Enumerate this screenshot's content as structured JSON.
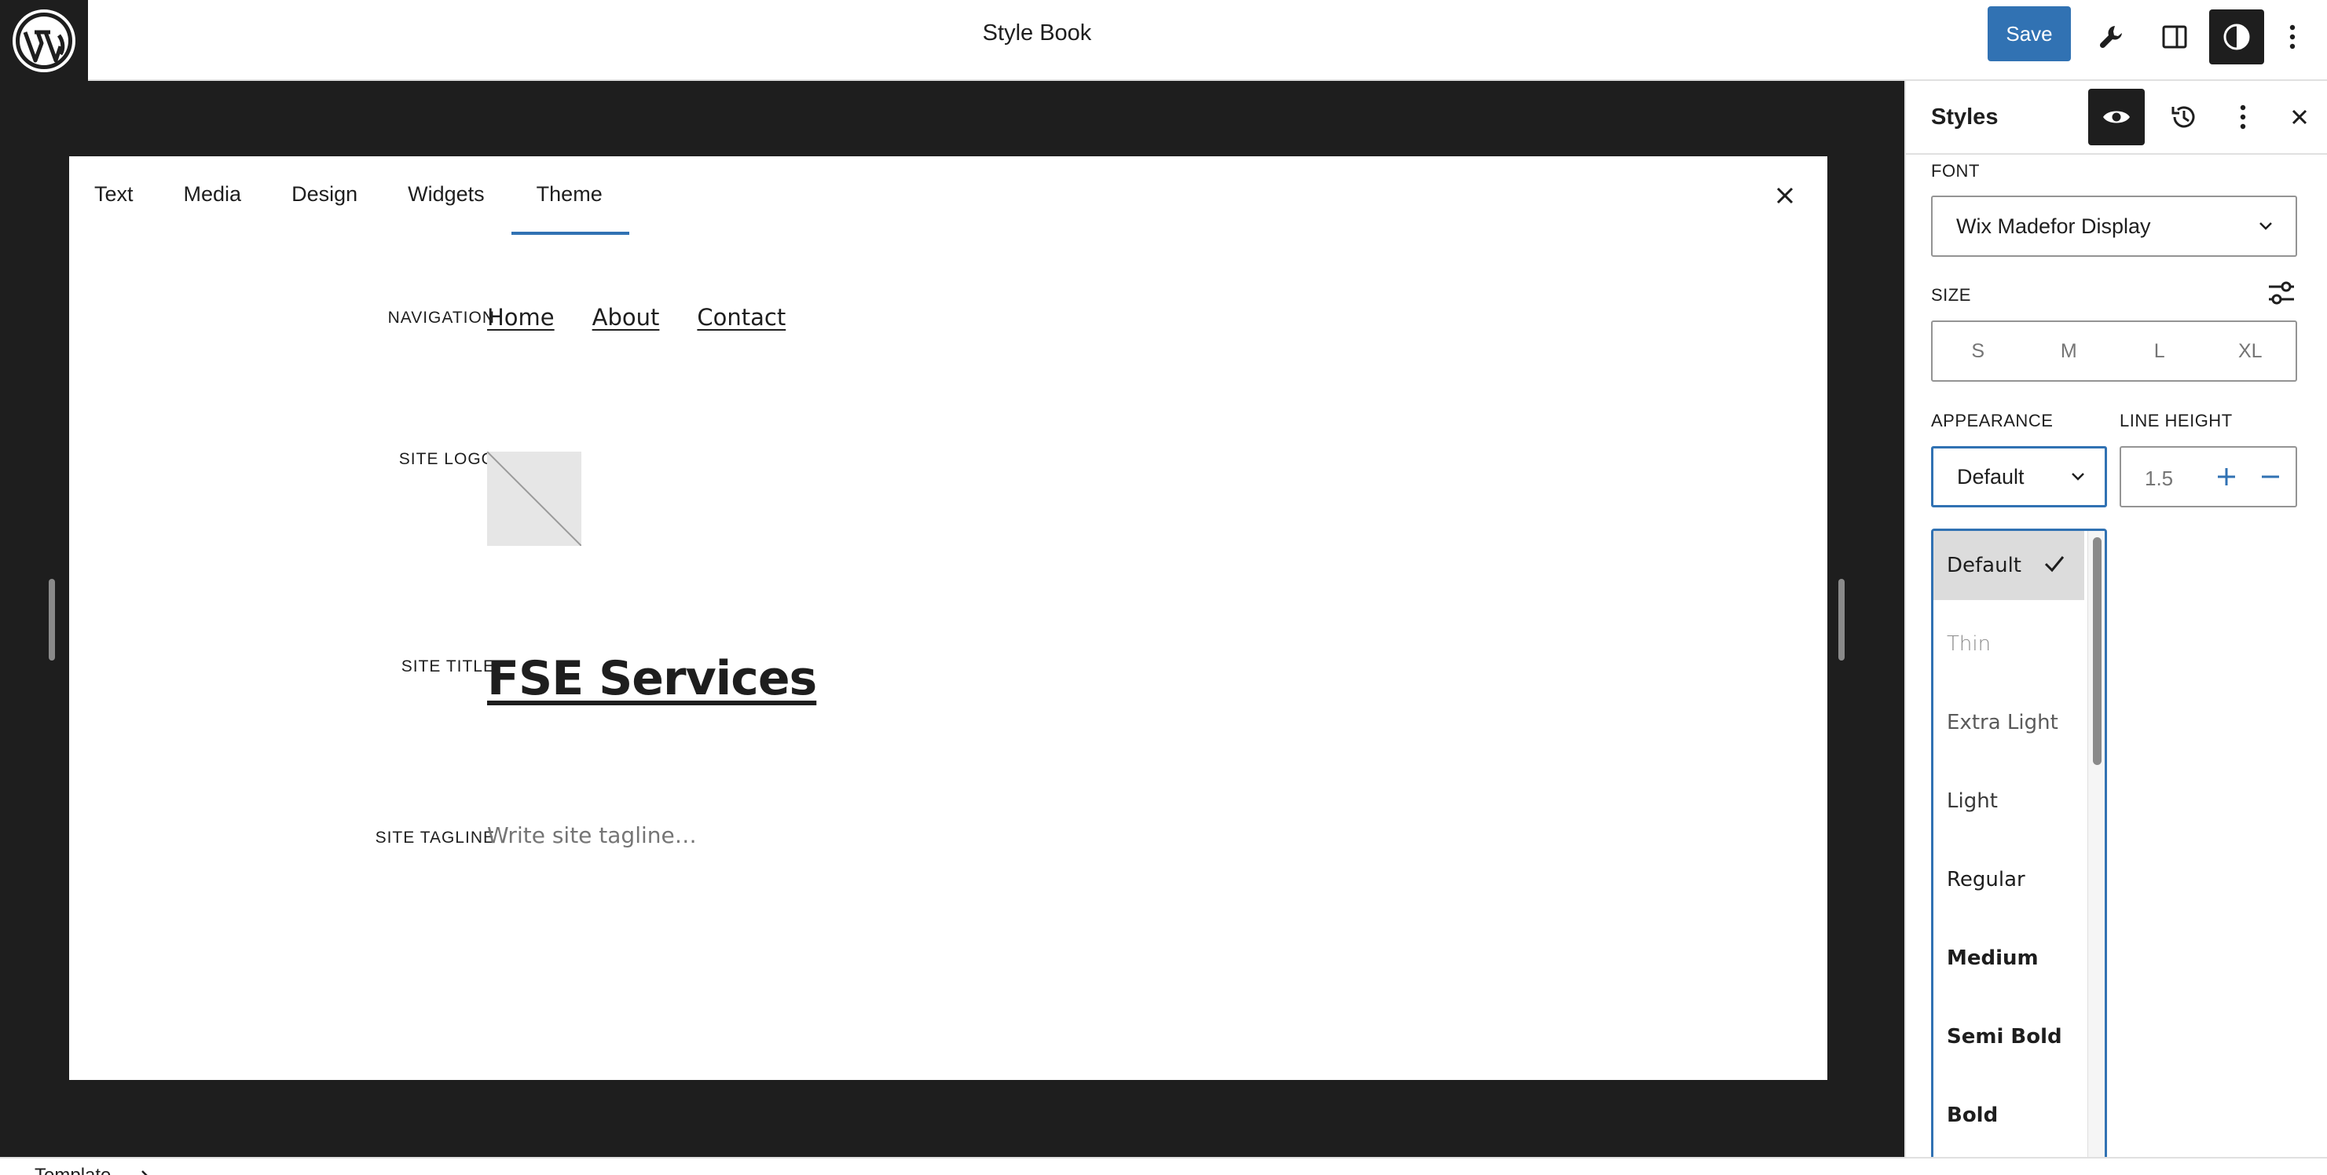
{
  "header": {
    "title": "Style Book",
    "save_label": "Save",
    "icons": [
      "wordpress-logo",
      "tools-icon",
      "sidebar-toggle-icon",
      "styles-contrast-icon",
      "options-icon"
    ]
  },
  "stylebook": {
    "tabs": [
      {
        "label": "Text"
      },
      {
        "label": "Media"
      },
      {
        "label": "Design"
      },
      {
        "label": "Widgets"
      },
      {
        "label": "Theme"
      }
    ],
    "active_tab": "Theme",
    "rows": {
      "navigation_label": "NAVIGATION",
      "nav_links": [
        "Home",
        "About",
        "Contact"
      ],
      "site_logo_label": "SITE LOGO",
      "site_title_label": "SITE TITLE",
      "site_title": "FSE Services",
      "site_tagline_label": "SITE TAGLINE",
      "tagline_placeholder": "Write site tagline…"
    }
  },
  "footer": {
    "breadcrumb": "Template"
  },
  "sidebar": {
    "title": "Styles",
    "font_label": "FONT",
    "font_value": "Wix Madefor Display",
    "size_label": "SIZE",
    "size_options": [
      "S",
      "M",
      "L",
      "XL"
    ],
    "appearance_label": "APPEARANCE",
    "appearance_value": "Default",
    "line_height_label": "LINE HEIGHT",
    "line_height_value": "1.5",
    "appearance_options": [
      "Default",
      "Thin",
      "Extra Light",
      "Light",
      "Regular",
      "Medium",
      "Semi Bold",
      "Bold"
    ],
    "selected_option": "Default"
  },
  "colors": {
    "accent": "#3172b3",
    "dark": "#1e1e1e",
    "canvas_bg": "#1e1e1e",
    "muted": "#757575"
  }
}
